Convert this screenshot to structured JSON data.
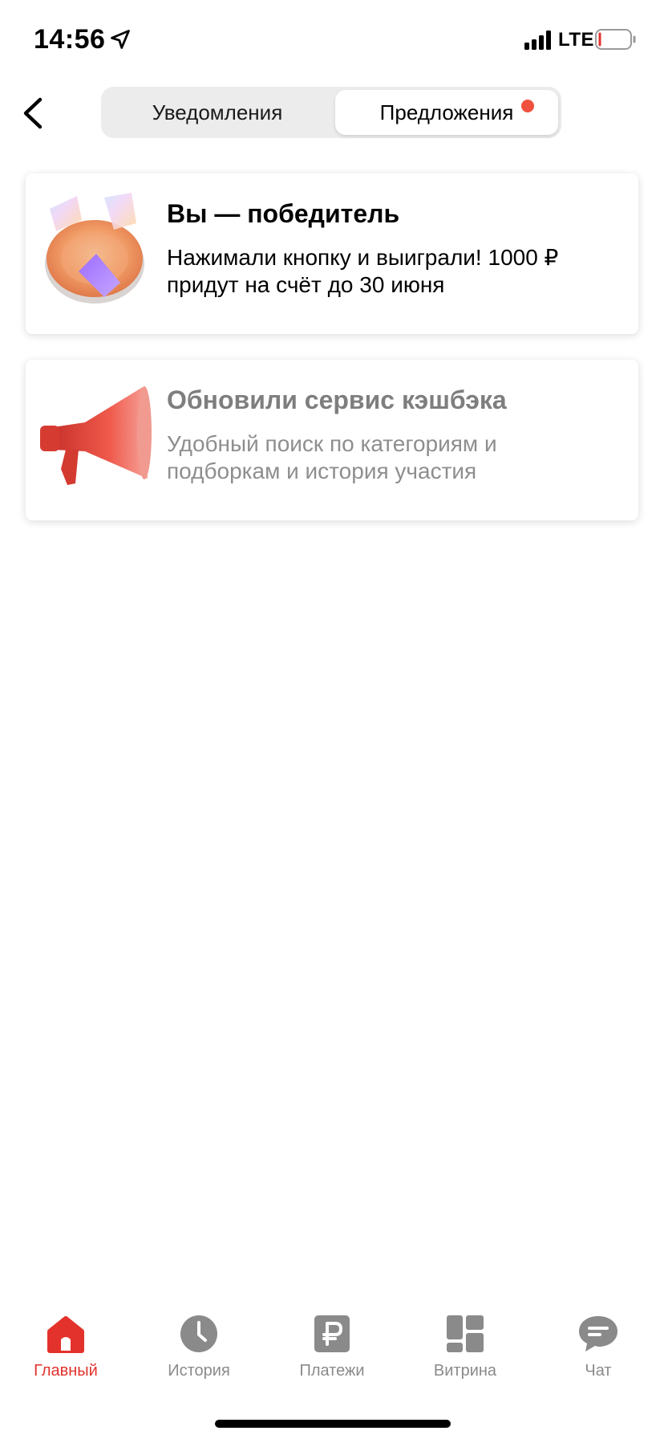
{
  "status_bar": {
    "time": "14:56",
    "network": "LTE",
    "icons": [
      "location-arrow-icon",
      "signal-bars-icon",
      "battery-low-icon"
    ]
  },
  "header": {
    "back_icon": "chevron-left-icon",
    "tabs": [
      {
        "label": "Уведомления",
        "selected": false
      },
      {
        "label": "Предложения",
        "selected": true,
        "has_badge": true
      }
    ]
  },
  "cards": [
    {
      "title": "Вы — победитель",
      "body": "Нажимали кнопку и выиграли! 1000 ₽\nпридут на счёт до 30 июня",
      "icon": "prize-plate-illustration",
      "read": false
    },
    {
      "title": "Обновили сервис кэшбэка",
      "body": "Удобный поиск по категориям и\nподборкам и история участия",
      "icon": "megaphone-illustration",
      "read": true
    }
  ],
  "tabbar": {
    "items": [
      {
        "label": "Главный",
        "icon": "home-icon",
        "active": true
      },
      {
        "label": "История",
        "icon": "clock-icon",
        "active": false
      },
      {
        "label": "Платежи",
        "icon": "ruble-icon",
        "active": false
      },
      {
        "label": "Витрина",
        "icon": "showcase-grid-icon",
        "active": false
      },
      {
        "label": "Чат",
        "icon": "chat-bubble-icon",
        "active": false
      }
    ]
  },
  "colors": {
    "accent": "#e3322c",
    "badge": "#f0513e",
    "inactive": "#8a8a8a",
    "segment_bg": "#ececed"
  }
}
